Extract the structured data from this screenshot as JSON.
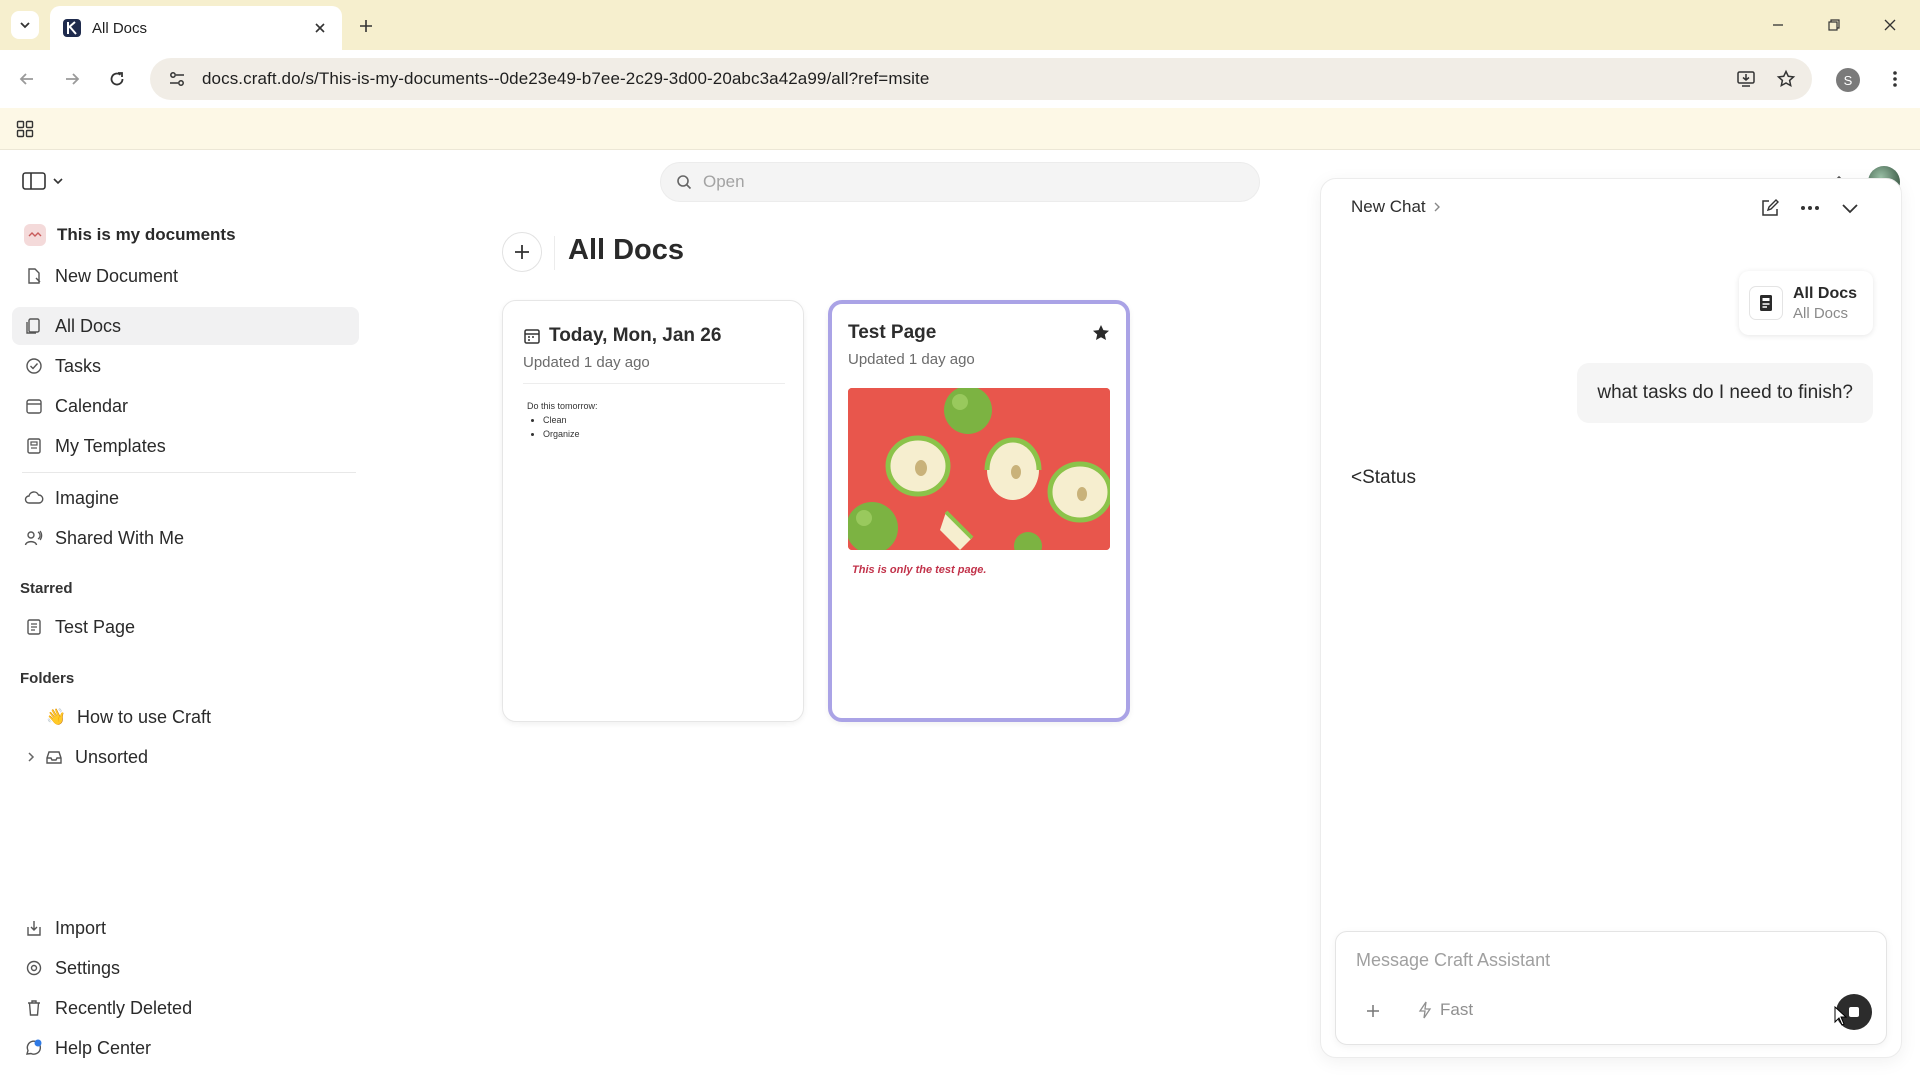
{
  "browser": {
    "tab_title": "All Docs",
    "url": "docs.craft.do/s/This-is-my-documents--0de23e49-b7ee-2c29-3d00-20abc3a42a99/all?ref=msite",
    "profile_initial": "S"
  },
  "app": {
    "search_placeholder": "Open",
    "sidebar": {
      "workspace": "This is my documents",
      "new_document": "New Document",
      "all_docs": "All Docs",
      "tasks": "Tasks",
      "calendar": "Calendar",
      "my_templates": "My Templates",
      "imagine": "Imagine",
      "shared_with_me": "Shared With Me",
      "starred_heading": "Starred",
      "starred_items": [
        "Test Page"
      ],
      "folders_heading": "Folders",
      "folders": [
        "How to use Craft",
        "Unsorted"
      ],
      "import": "Import",
      "settings": "Settings",
      "recently_deleted": "Recently Deleted",
      "help_center": "Help Center"
    },
    "main": {
      "title": "All Docs",
      "cards": [
        {
          "title": "Today, Mon, Jan 26",
          "updated": "Updated 1 day ago",
          "preview_heading": "Do this tomorrow:",
          "preview_items": [
            "Clean",
            "Organize"
          ]
        },
        {
          "title": "Test Page",
          "updated": "Updated 1 day ago",
          "starred": true,
          "caption": "This is only the test page."
        }
      ]
    },
    "chat": {
      "title": "New Chat",
      "context_name": "All Docs",
      "context_sub": "All Docs",
      "user_message": "what tasks do I need to finish?",
      "assistant_message": "<Status",
      "composer_placeholder": "Message Craft Assistant",
      "model_label": "Fast"
    }
  },
  "colors": {
    "tabstrip": "#f6efce",
    "bookmarkbar": "#fdf8e6",
    "selected_card_border": "#aaa3e6",
    "image_background": "#e8564c",
    "caption_text": "#c2324a"
  }
}
